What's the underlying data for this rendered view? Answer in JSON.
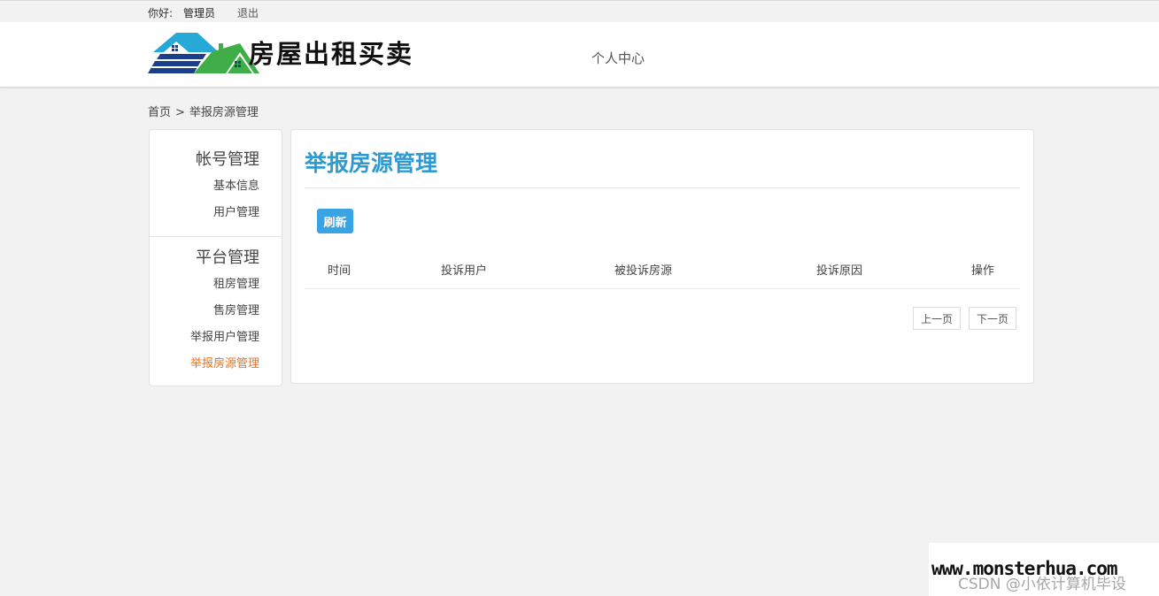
{
  "topbar": {
    "greeting": "你好:",
    "username": "管理员",
    "logout": "退出"
  },
  "header": {
    "site_title": "房屋出租买卖",
    "nav_center": "个人中心",
    "logo_icon": "house-logo-icon",
    "colors": {
      "house_blue": "#27a9d8",
      "house_green": "#3fae49",
      "house_navy": "#1b3f8b"
    }
  },
  "breadcrumb": {
    "home": "首页",
    "separator": ">",
    "current": "举报房源管理"
  },
  "sidebar": {
    "groups": [
      {
        "title": "帐号管理",
        "items": [
          "基本信息",
          "用户管理"
        ]
      },
      {
        "title": "平台管理",
        "items": [
          "租房管理",
          "售房管理",
          "举报用户管理",
          "举报房源管理"
        ]
      }
    ],
    "active_item": "举报房源管理",
    "active_color": "#e0762b"
  },
  "panel": {
    "title": "举报房源管理",
    "title_color": "#2d9bd2",
    "refresh_label": "刷新",
    "columns": [
      "时间",
      "投诉用户",
      "被投诉房源",
      "投诉原因",
      "操作"
    ],
    "rows": [],
    "pagination": {
      "prev": "上一页",
      "next": "下一页"
    }
  },
  "watermark": {
    "url": "www.monsterhua.com",
    "csdn": "CSDN @小依计算机毕设"
  }
}
